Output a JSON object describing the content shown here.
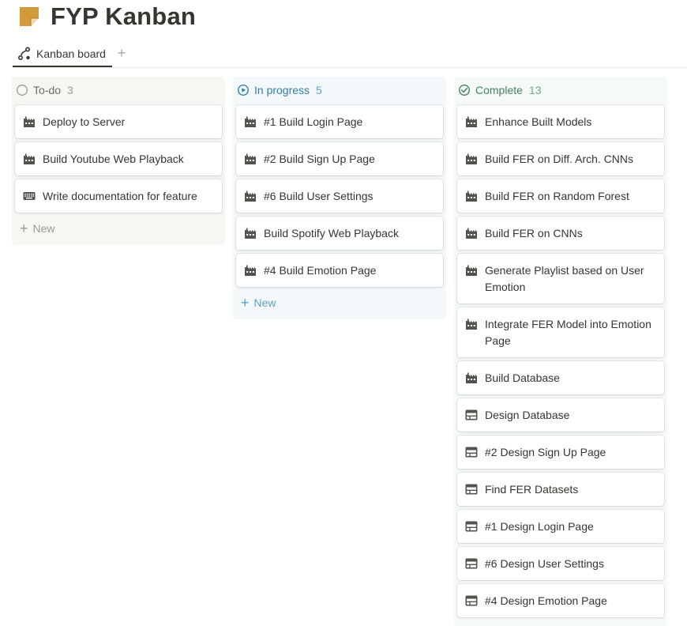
{
  "page": {
    "title": "FYP Kanban",
    "icon": "sticky-note-icon",
    "icon_color": "#d29a38"
  },
  "views": {
    "active_tab": "Kanban board",
    "add_view_label": "+"
  },
  "columns": [
    {
      "title": "To-do",
      "count": "3",
      "status_icon": "circle-empty-icon",
      "color": "#6b6a66",
      "cards": [
        {
          "title": "Deploy to Server",
          "icon": "factory-icon"
        },
        {
          "title": "Build Youtube Web Playback",
          "icon": "factory-icon"
        },
        {
          "title": "Write documentation for feature",
          "icon": "keyboard-icon"
        }
      ],
      "new_label": "New"
    },
    {
      "title": "In progress",
      "count": "5",
      "status_icon": "play-circle-icon",
      "color": "#337ea9",
      "cards": [
        {
          "title": "#1 Build Login Page",
          "icon": "factory-icon"
        },
        {
          "title": "#2 Build Sign Up Page",
          "icon": "factory-icon"
        },
        {
          "title": "#6 Build User Settings",
          "icon": "factory-icon"
        },
        {
          "title": "Build Spotify Web Playback",
          "icon": "factory-icon"
        },
        {
          "title": "#4 Build Emotion Page",
          "icon": "factory-icon"
        }
      ],
      "new_label": "New"
    },
    {
      "title": "Complete",
      "count": "13",
      "status_icon": "check-circle-icon",
      "color": "#448361",
      "cards": [
        {
          "title": "Enhance Built Models",
          "icon": "factory-icon"
        },
        {
          "title": "Build FER on Diff. Arch. CNNs",
          "icon": "factory-icon"
        },
        {
          "title": "Build FER on Random Forest",
          "icon": "factory-icon"
        },
        {
          "title": "Build FER on CNNs",
          "icon": "factory-icon"
        },
        {
          "title": "Generate Playlist based on User Emotion",
          "icon": "factory-icon"
        },
        {
          "title": "Integrate FER Model into Emotion Page",
          "icon": "factory-icon"
        },
        {
          "title": "Build Database",
          "icon": "factory-icon"
        },
        {
          "title": "Design Database",
          "icon": "layout-icon"
        },
        {
          "title": "#2 Design Sign Up Page",
          "icon": "layout-icon"
        },
        {
          "title": "Find FER Datasets",
          "icon": "layout-icon"
        },
        {
          "title": "#1 Design Login Page",
          "icon": "layout-icon"
        },
        {
          "title": "#6 Design User Settings",
          "icon": "layout-icon"
        },
        {
          "title": "#4 Design Emotion Page",
          "icon": "layout-icon"
        }
      ]
    }
  ]
}
